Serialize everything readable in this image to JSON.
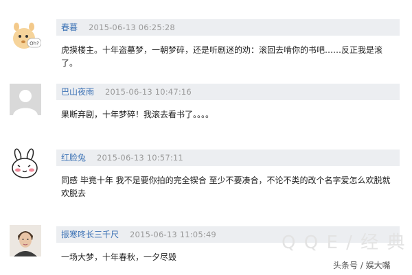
{
  "comments": [
    {
      "user": "春暮",
      "time": "2015-06-13 06:25:28",
      "text": "虎摸楼主。十年盗墓梦，一朝梦碎，还是听剧迷的劝：滚回去啃你的书吧……反正我是滚了。",
      "avatar_icon": "cartoon-cat-oh-avatar",
      "avatar_badge": "Oh?"
    },
    {
      "user": "巴山夜雨",
      "time": "2015-06-13 10:47:16",
      "text": "果断弃剧，十年梦碎！我滚去看书了。。。。",
      "avatar_icon": "default-user-avatar"
    },
    {
      "user": "红脸兔",
      "time": "2015-06-13 10:57:11",
      "text": "同感 毕竟十年 我不是要你拍的完全锲合 至少不要凑合，不论不类的改个名字爱怎么欢脱就欢脱去",
      "avatar_icon": "blushing-rabbit-avatar"
    },
    {
      "user": "振寒咚长三千尺",
      "time": "2015-06-13 11:05:49",
      "text": "一场大梦，十年春秋，一夕尽毁",
      "avatar_icon": "man-portrait-avatar"
    }
  ],
  "watermark": "头条号 / 娱大嘴",
  "background_watermark": "Q Q E / 经 典 网"
}
